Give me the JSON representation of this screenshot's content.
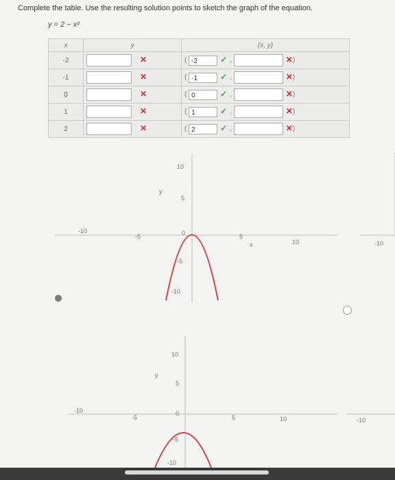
{
  "instruction": "Complete the table. Use the resulting solution points to sketch the graph of the equation.",
  "equation": "y = 2 − x²",
  "table": {
    "headers": {
      "x": "x",
      "y": "y",
      "point": "(x, y)"
    },
    "rows": [
      {
        "x": "-2",
        "x_in_point": "-2"
      },
      {
        "x": "-1",
        "x_in_point": "-1"
      },
      {
        "x": "0",
        "x_in_point": "0"
      },
      {
        "x": "1",
        "x_in_point": "1"
      },
      {
        "x": "2",
        "x_in_point": "2"
      }
    ],
    "wrong_mark": "✕",
    "check_mark": "✓",
    "open_paren": "(",
    "close_paren": ")",
    "comma": ","
  },
  "graph1": {
    "labels": {
      "y_axis": "y",
      "x_axis": "x",
      "y10": "10",
      "y5": "5",
      "ym5": "-5",
      "ym10": "-10",
      "xm10": "-10",
      "xm5": "-5",
      "x5": "5",
      "x10": "10",
      "origin": "0",
      "right_m10": "-10"
    }
  },
  "graph2": {
    "labels": {
      "y_axis": "y",
      "y10": "10",
      "y5": "5",
      "ym5": "-5",
      "ym10": "-10",
      "xm10": "-10",
      "xm5": "-5",
      "x5": "5",
      "x10": "10",
      "origin": "0",
      "right_m10": "-10"
    }
  },
  "colors": {
    "curve": "#d64545",
    "axis": "#bdbdbd",
    "wrong": "#d62a3a",
    "check": "#3aa34a"
  }
}
